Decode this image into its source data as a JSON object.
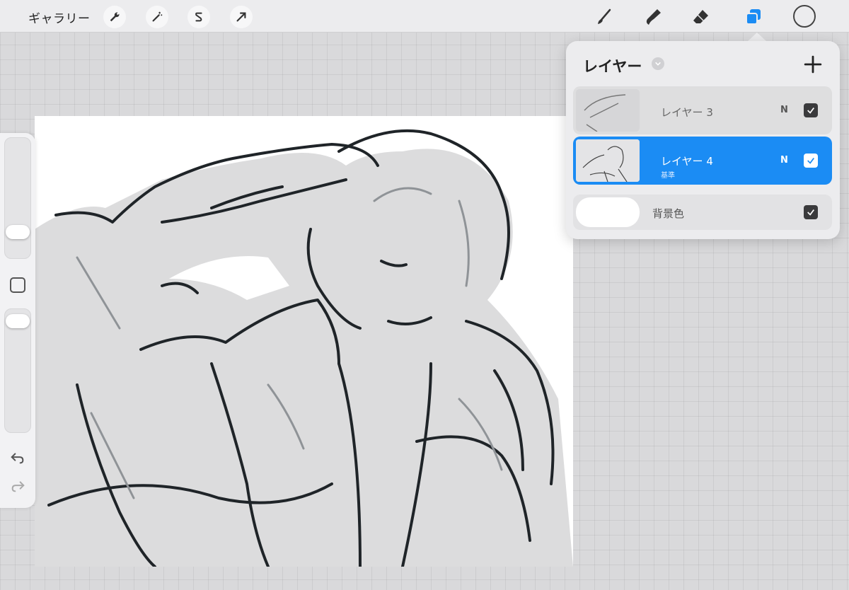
{
  "toolbar": {
    "gallery_label": "ギャラリー",
    "left_tools": [
      "wrench-icon",
      "magic-wand-icon",
      "selection-s-icon",
      "transform-arrow-icon"
    ],
    "right_tools": [
      "brush-icon",
      "smudge-icon",
      "eraser-icon",
      "layers-icon"
    ],
    "active_tool": "layers-icon",
    "current_color": "#ececee",
    "accent_color": "#1b8cf4"
  },
  "sidebar": {
    "brush_size_slider": "brush-size",
    "opacity_slider": "opacity",
    "undo_icon": "undo-icon",
    "redo_icon": "redo-icon"
  },
  "layers_panel": {
    "title": "レイヤー",
    "add_button": "+",
    "layers": [
      {
        "name": "レイヤー 3",
        "mode": "N",
        "visible": true,
        "active": false,
        "sublabel": ""
      },
      {
        "name": "レイヤー 4",
        "mode": "N",
        "visible": true,
        "active": true,
        "sublabel": "基準"
      }
    ],
    "background": {
      "name": "背景色",
      "color": "#ffffff",
      "visible": true
    }
  }
}
